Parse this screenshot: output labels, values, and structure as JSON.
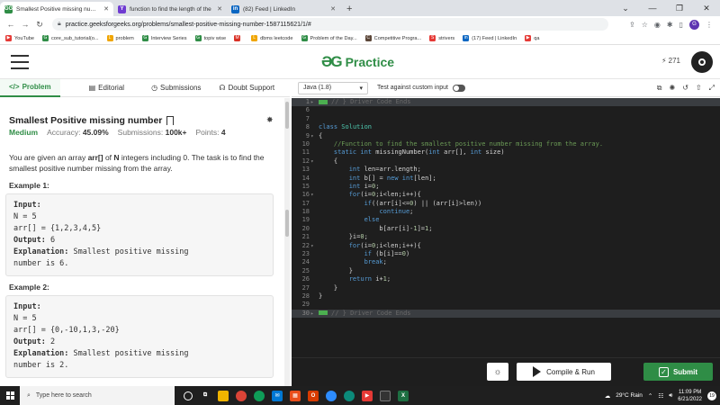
{
  "browser": {
    "tabs": [
      {
        "title": "Smallest Positive missing numbe",
        "favicon": "GG",
        "color": "#2f8d46"
      },
      {
        "title": "function to find the length of the",
        "favicon": "Y",
        "color": "#6f3bd1"
      },
      {
        "title": "(82) Feed | LinkedIn",
        "favicon": "in",
        "color": "#0a66c2"
      }
    ],
    "new_tab": "+",
    "url": "practice.geeksforgeeks.org/problems/smallest-positive-missing-number-1587115621/1/#",
    "bookmarks": [
      {
        "label": "YouTube",
        "icon": "youtube-icon",
        "color": "#e53935",
        "glyph": "▶"
      },
      {
        "label": "core_sub_tutorial(o...",
        "icon": "gfg-icon",
        "color": "#2f8d46",
        "glyph": "G"
      },
      {
        "label": "problem",
        "icon": "leetcode-icon",
        "color": "#f0a500",
        "glyph": "L"
      },
      {
        "label": "Interview Series",
        "icon": "gfg-icon",
        "color": "#2f8d46",
        "glyph": "G"
      },
      {
        "label": "topiv wise",
        "icon": "gfg-icon",
        "color": "#2f8d46",
        "glyph": "G"
      },
      {
        "label": "",
        "icon": "gmail-icon",
        "color": "#d93025",
        "glyph": "M"
      },
      {
        "label": "dbms leetcode",
        "icon": "leetcode-icon",
        "color": "#f0a500",
        "glyph": "L"
      },
      {
        "label": "Problem of the Day...",
        "icon": "gfg-icon",
        "color": "#2f8d46",
        "glyph": "G"
      },
      {
        "label": "Competitive Progra...",
        "icon": "codechef-icon",
        "color": "#5b4638",
        "glyph": "C"
      },
      {
        "label": "strivers",
        "icon": "strivers-icon",
        "color": "#e53935",
        "glyph": "S"
      },
      {
        "label": "(17) Feed | LinkedIn",
        "icon": "linkedin-icon",
        "color": "#0a66c2",
        "glyph": "in"
      },
      {
        "label": "qa",
        "icon": "youtube-icon",
        "color": "#e53935",
        "glyph": "▶"
      }
    ]
  },
  "header": {
    "logo_mark": "ƏG",
    "logo_text": "Practice",
    "streak": "271"
  },
  "left_tabs": [
    {
      "label": "Problem",
      "icon": "</>"
    },
    {
      "label": "Editorial",
      "icon": "▤"
    },
    {
      "label": "Submissions",
      "icon": "◷"
    },
    {
      "label": "Doubt Support",
      "icon": "☊"
    }
  ],
  "problem": {
    "title": "Smallest Positive missing number",
    "difficulty": "Medium",
    "accuracy_label": "Accuracy:",
    "accuracy": "45.09%",
    "submissions_label": "Submissions:",
    "submissions": "100k+",
    "points_label": "Points:",
    "points": "4",
    "desc_before_arr": "You are given an array ",
    "desc_arr": "arr[]",
    "desc_mid": " of ",
    "desc_n": "N",
    "desc_after": " integers including 0. The task is to find the smallest positive number missing from the array.",
    "example1_title": "Example 1:",
    "example2_title": "Example 2:",
    "input_label": "Input:",
    "output_label": "Output:",
    "explanation_label": "Explanation:",
    "ex1_n": "N = 5",
    "ex1_arr": "arr[] = {1,2,3,4,5}",
    "ex1_output": " 6",
    "ex1_expl1": " Smallest positive missing",
    "ex1_expl2": "number is 6.",
    "ex2_n": "N = 5",
    "ex2_arr": "arr[] = {0,-10,1,3,-20}",
    "ex2_output": " 2",
    "ex2_expl1": " Smallest positive missing",
    "ex2_expl2": "number is 2."
  },
  "editor_toolbar": {
    "language": "Java (1.8)",
    "custom_input": "Test against custom input"
  },
  "code_lines": [
    {
      "n": "1",
      "fold": "▸",
      "t": "// } Driver Code Ends",
      "cls": "ghost",
      "hl": true,
      "badge": true
    },
    {
      "n": "6",
      "t": ""
    },
    {
      "n": "7",
      "t": ""
    },
    {
      "n": "8",
      "t": "class Solution"
    },
    {
      "n": "9",
      "fold": "▾",
      "t": "{"
    },
    {
      "n": "10",
      "t": "    //Function to find the smallest positive number missing from the array.",
      "cls": "cm"
    },
    {
      "n": "11",
      "t": "    static int missingNumber(int arr[], int size)"
    },
    {
      "n": "12",
      "fold": "▾",
      "t": "    {"
    },
    {
      "n": "13",
      "t": "        int len=arr.length;"
    },
    {
      "n": "14",
      "t": "        int b[] = new int[len];"
    },
    {
      "n": "15",
      "t": "        int i=0;"
    },
    {
      "n": "16",
      "fold": "▾",
      "t": "        for(i=0;i<len;i++){"
    },
    {
      "n": "17",
      "t": "            if((arr[i]<=0) || (arr[i]>len))"
    },
    {
      "n": "18",
      "t": "                continue;"
    },
    {
      "n": "19",
      "t": "            else"
    },
    {
      "n": "20",
      "t": "                b[arr[i]-1]=1;"
    },
    {
      "n": "21",
      "t": "        }i=0;"
    },
    {
      "n": "22",
      "fold": "▾",
      "t": "        for(i=0;i<len;i++){"
    },
    {
      "n": "23",
      "t": "            if (b[i]==0)"
    },
    {
      "n": "24",
      "t": "            break;"
    },
    {
      "n": "25",
      "t": "        }"
    },
    {
      "n": "26",
      "t": "        return i+1;"
    },
    {
      "n": "27",
      "t": "    }"
    },
    {
      "n": "28",
      "t": "}"
    },
    {
      "n": "29",
      "t": ""
    },
    {
      "n": "30",
      "fold": "▸",
      "t": "// } Driver Code Ends",
      "cls": "ghost",
      "hl": true,
      "badge": true
    }
  ],
  "buttons": {
    "run": "Compile & Run",
    "submit": "Submit"
  },
  "taskbar": {
    "search_placeholder": "Type here to search",
    "weather": "29°C  Rain",
    "time": "11:09 PM",
    "date": "6/21/2022",
    "notifications": "19"
  }
}
